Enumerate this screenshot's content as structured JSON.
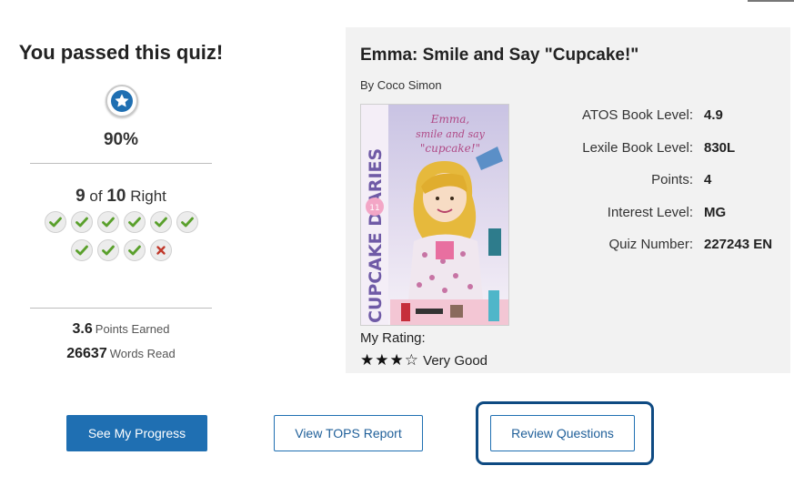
{
  "result": {
    "title": "You passed this quiz!",
    "badge_icon": "star-icon",
    "percent": "90%",
    "score_right": "9",
    "score_of": "of",
    "score_total": "10",
    "score_suffix": "Right",
    "answers": [
      "correct",
      "correct",
      "correct",
      "correct",
      "correct",
      "correct",
      "correct",
      "correct",
      "correct",
      "incorrect"
    ],
    "points_value": "3.6",
    "points_label": "Points Earned",
    "words_value": "26637",
    "words_label": "Words Read"
  },
  "book": {
    "title": "Emma: Smile and Say \"Cupcake!\"",
    "author": "By Coco Simon",
    "cover_title": "Emma, smile and say \"cupcake!\"",
    "cover_series": "CUPCAKE DIARIES",
    "cover_number": "11",
    "details": [
      {
        "label": "ATOS Book Level:",
        "value": "4.9"
      },
      {
        "label": "Lexile Book Level:",
        "value": "830L"
      },
      {
        "label": "Points:",
        "value": "4"
      },
      {
        "label": "Interest Level:",
        "value": "MG"
      },
      {
        "label": "Quiz Number:",
        "value": "227243 EN"
      }
    ],
    "rating_label": "My Rating:",
    "rating_stars": "★★★☆",
    "rating_text": "Very Good",
    "rating_value": 3,
    "rating_max": 4
  },
  "buttons": {
    "progress": "See My Progress",
    "tops": "View TOPS Report",
    "review": "Review Questions"
  },
  "colors": {
    "primary": "#1f6fb2",
    "focus": "#0e4a82",
    "correct": "#5aa02c",
    "incorrect": "#c0392b",
    "card_bg": "#f2f2f2"
  }
}
